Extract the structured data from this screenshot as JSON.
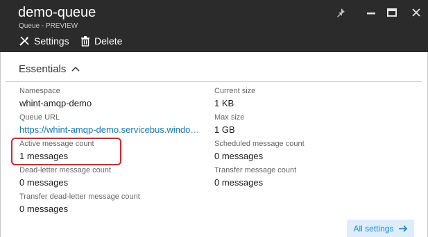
{
  "blade": {
    "title": "demo-queue",
    "subtitle": "Queue - PREVIEW"
  },
  "window_controls": [
    "pin-icon",
    "minimize-icon",
    "maximize-icon",
    "close-icon"
  ],
  "commands": {
    "settings_label": "Settings",
    "delete_label": "Delete"
  },
  "essentials": {
    "header_label": "Essentials",
    "left": [
      {
        "label": "Namespace",
        "value": "whint-amqp-demo"
      },
      {
        "label": "Queue URL",
        "value": "https://whint-amqp-demo.servicebus.windows.net/demo-queue"
      },
      {
        "label": "Active message count",
        "value": "1 messages"
      },
      {
        "label": "Dead-letter message count",
        "value": "0 messages"
      },
      {
        "label": "Transfer dead-letter message count",
        "value": "0 messages"
      }
    ],
    "right": [
      {
        "label": "Current size",
        "value": "1 KB"
      },
      {
        "label": "Max size",
        "value": "1 GB"
      },
      {
        "label": "Scheduled message count",
        "value": "0 messages"
      },
      {
        "label": "Transfer message count",
        "value": "0 messages"
      }
    ],
    "all_settings_label": "All settings"
  },
  "colors": {
    "header_bg": "#2b2b2b",
    "link": "#0a7bc1",
    "highlight": "#e0202a",
    "all_settings_bg": "#ddeefa"
  }
}
